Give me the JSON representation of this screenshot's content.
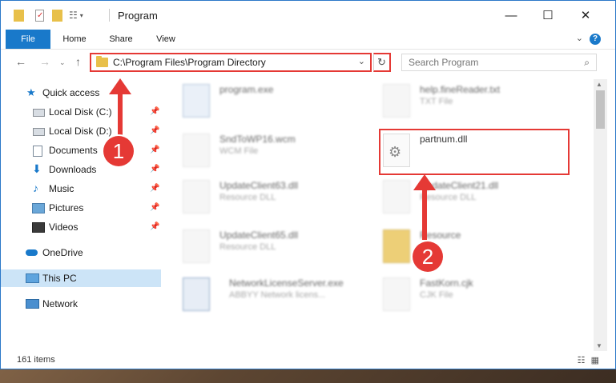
{
  "window": {
    "title": "Program"
  },
  "ribbon": {
    "tabs": [
      "File",
      "Home",
      "Share",
      "View"
    ],
    "help": "?"
  },
  "titlebar": {
    "minimize": "—",
    "maximize": "☐",
    "close": "✕"
  },
  "address": {
    "path": "C:\\Program Files\\Program Directory"
  },
  "search": {
    "placeholder": "Search Program"
  },
  "nav": {
    "quick_access": "Quick access",
    "items": [
      {
        "label": "Local Disk (C:)",
        "icon": "drive-icon",
        "pinned": true
      },
      {
        "label": "Local Disk (D:)",
        "icon": "drive-icon",
        "pinned": true
      },
      {
        "label": "Documents",
        "icon": "documents-icon",
        "pinned": true
      },
      {
        "label": "Downloads",
        "icon": "downloads-icon",
        "pinned": true
      },
      {
        "label": "Music",
        "icon": "music-icon",
        "pinned": true
      },
      {
        "label": "Pictures",
        "icon": "pictures-icon",
        "pinned": true
      },
      {
        "label": "Videos",
        "icon": "videos-icon",
        "pinned": true
      }
    ],
    "onedrive": "OneDrive",
    "thispc": "This PC",
    "network": "Network"
  },
  "files": [
    {
      "name": "program.exe",
      "type": ""
    },
    {
      "name": "help.fineReader.txt",
      "type": "TXT File"
    },
    {
      "name": "SndToWP16.wcm",
      "type": "WCM File"
    },
    {
      "name": "partnum.dll",
      "type": ""
    },
    {
      "name": "UpdateClient63.dll",
      "type": "Resource DLL"
    },
    {
      "name": "UpdateClient21.dll",
      "type": "Resource DLL"
    },
    {
      "name": "UpdateClient65.dll",
      "type": "Resource DLL"
    },
    {
      "name": "Resource",
      "type": ""
    },
    {
      "name": "NetworkLicenseServer.exe",
      "type": "ABBYY Network licens..."
    },
    {
      "name": "FastKorn.cjk",
      "type": "CJK File"
    }
  ],
  "status": {
    "items": "161 items"
  },
  "annotations": {
    "one": "1",
    "two": "2"
  },
  "colors": {
    "accent": "#1979ca",
    "annotation": "#e53935"
  }
}
